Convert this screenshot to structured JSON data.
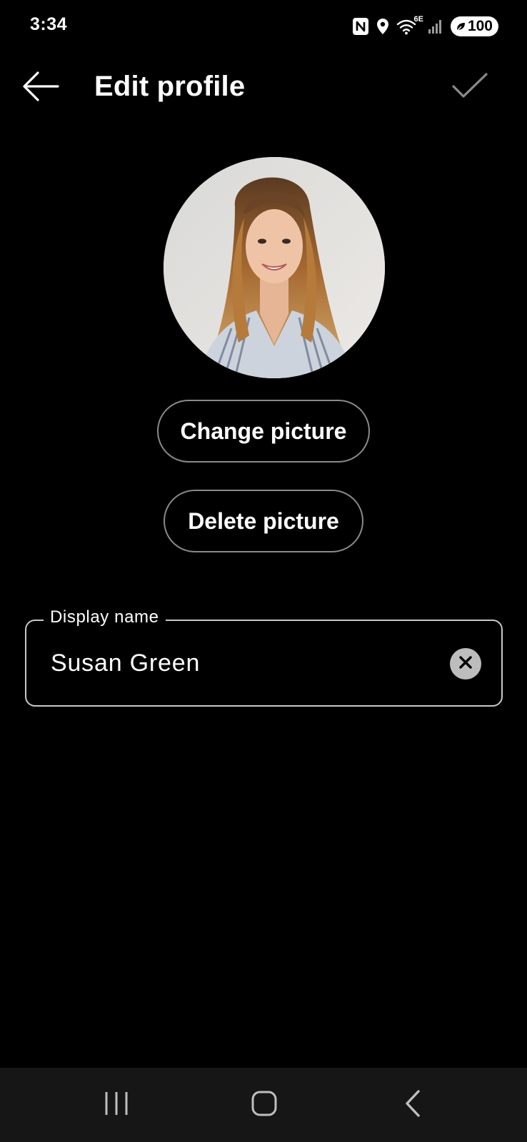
{
  "status_bar": {
    "time": "3:34",
    "network_label": "6E",
    "battery": "100",
    "icons": [
      "nfc-icon",
      "location-icon",
      "wifi-icon",
      "signal-icon",
      "battery-saver-icon"
    ]
  },
  "app_bar": {
    "title": "Edit profile",
    "back_icon": "arrow-left-icon",
    "confirm_icon": "checkmark-icon"
  },
  "profile": {
    "avatar_alt": "profile-photo",
    "change_picture_label": "Change picture",
    "delete_picture_label": "Delete picture"
  },
  "display_name_field": {
    "label": "Display name",
    "value": "Susan Green",
    "clear_icon": "clear-icon"
  },
  "nav_bar": {
    "items": [
      "recents-icon",
      "home-icon",
      "back-icon"
    ]
  },
  "colors": {
    "background": "#000000",
    "text": "#ffffff",
    "button_border": "#8a8a8a",
    "field_border": "#c8c8c8",
    "nav_background": "#161616"
  }
}
